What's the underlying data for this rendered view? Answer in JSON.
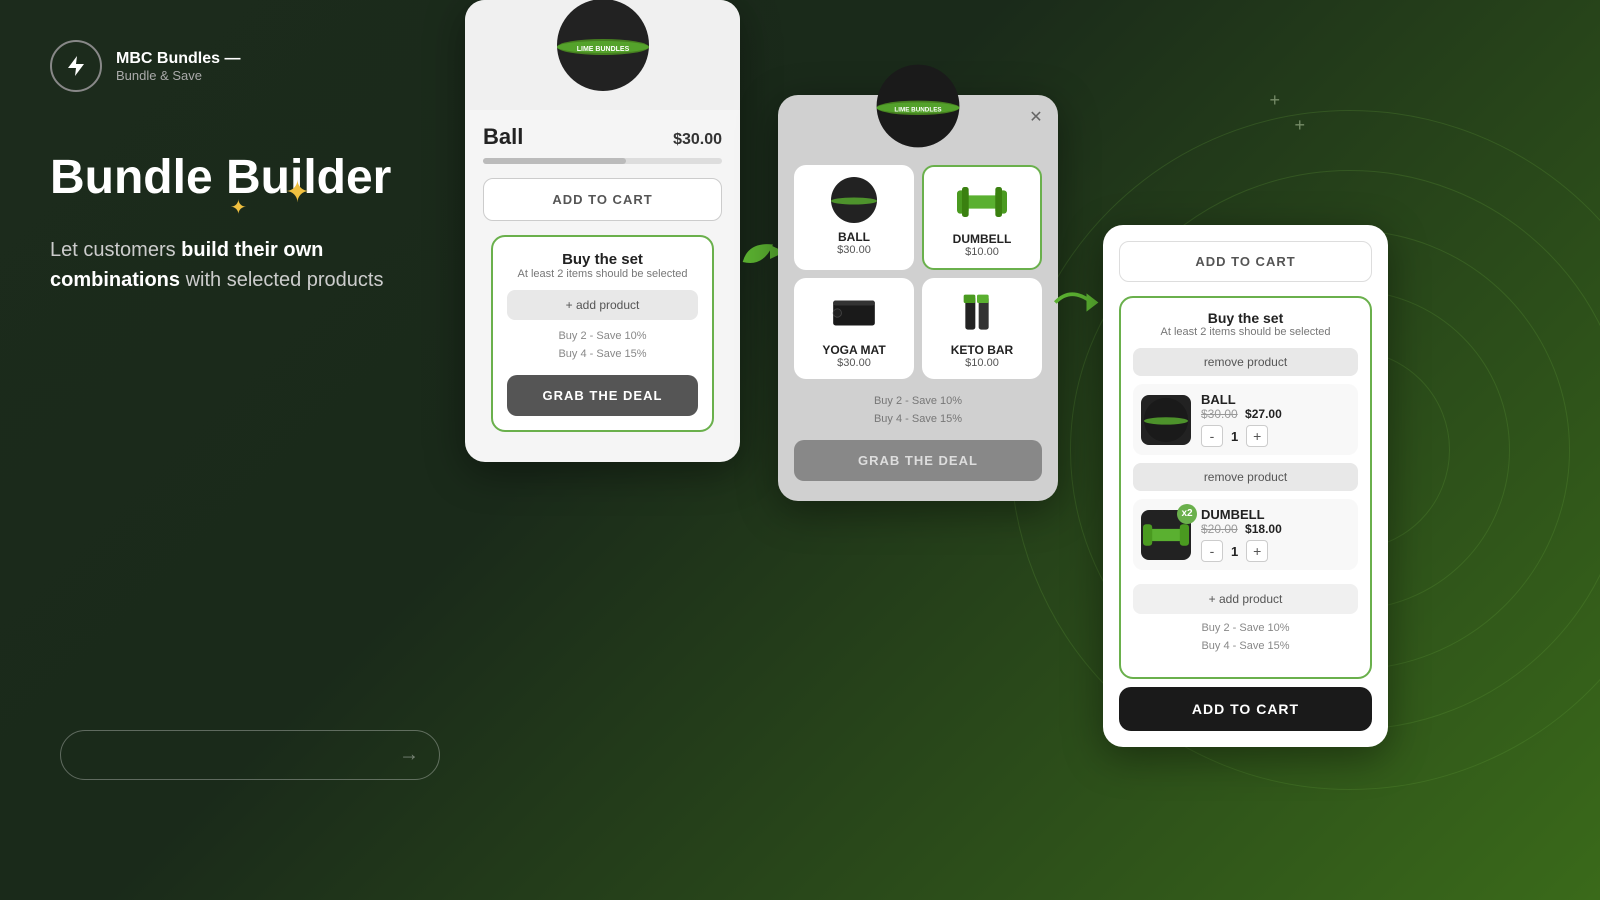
{
  "background": "#1c2b1c",
  "logo": {
    "icon": "⚡",
    "title": "MBC Bundles —",
    "subtitle": "Bundle & Save"
  },
  "hero": {
    "heading": "Bundle Builder",
    "description_start": "Let customers ",
    "description_bold": "build their own combinations",
    "description_end": " with selected products"
  },
  "card1": {
    "product_name": "Ball",
    "product_price": "$30.00",
    "add_to_cart_label": "ADD TO CART",
    "bundle_title": "Buy the set",
    "bundle_sub": "At least 2 items should be selected",
    "add_product_label": "+ add product",
    "savings_line1": "Buy 2 - Save 10%",
    "savings_line2": "Buy 4 - Save 15%",
    "grab_deal_label": "GRAB THE DEAL"
  },
  "card2": {
    "products": [
      {
        "name": "BALL",
        "price": "$30.00",
        "selected": false
      },
      {
        "name": "DUMBELL",
        "price": "$10.00",
        "selected": true
      },
      {
        "name": "YOGA MAT",
        "price": "$30.00",
        "selected": false
      },
      {
        "name": "KETO BAR",
        "price": "$10.00",
        "selected": false
      }
    ],
    "savings_line1": "Buy 2 - Save 10%",
    "savings_line2": "Buy 4 - Save 15%",
    "grab_deal_label": "GRAB THE DEAL"
  },
  "card3": {
    "add_to_cart_top_label": "ADD TO CART",
    "bundle_title": "Buy the set",
    "bundle_sub": "At least 2 items should be selected",
    "remove_product_label": "remove product",
    "items": [
      {
        "name": "BALL",
        "price_original": "$30.00",
        "price_sale": "$27.00",
        "qty": 1,
        "has_badge": false
      },
      {
        "name": "DUMBELL",
        "price_original": "$20.00",
        "price_sale": "$18.00",
        "qty": 1,
        "has_badge": true,
        "badge_label": "x2"
      }
    ],
    "add_product_label": "+ add product",
    "savings_line1": "Buy 2 - Save 10%",
    "savings_line2": "Buy 4 - Save 15%",
    "add_to_cart_bottom_label": "ADD TO CART"
  },
  "decorations": {
    "plus1": "+",
    "plus2": "+"
  }
}
